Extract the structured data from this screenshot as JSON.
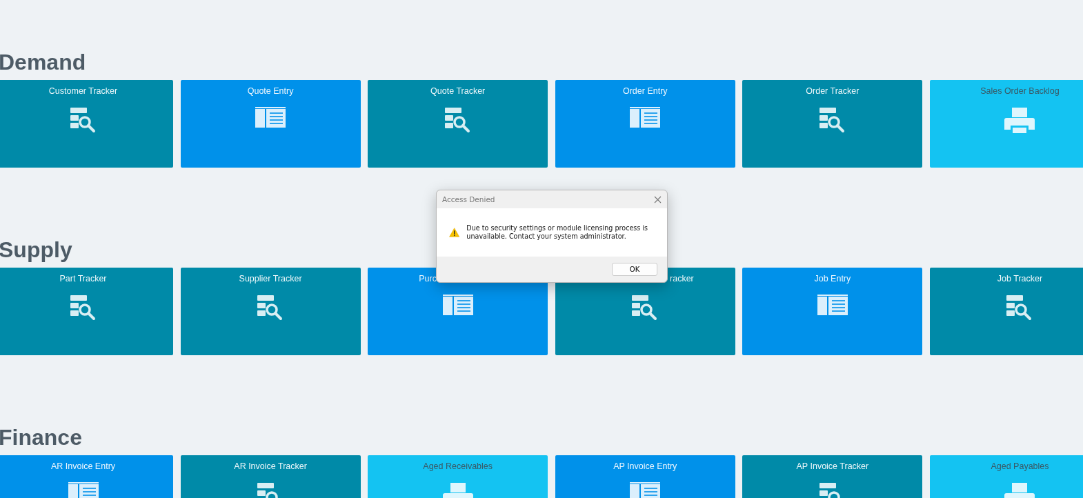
{
  "sections": [
    {
      "title": "Demand",
      "tiles": [
        {
          "label": "Customer Tracker",
          "kind": "tracker"
        },
        {
          "label": "Quote Entry",
          "kind": "entry"
        },
        {
          "label": "Quote Tracker",
          "kind": "tracker"
        },
        {
          "label": "Order Entry",
          "kind": "entry"
        },
        {
          "label": "Order Tracker",
          "kind": "tracker"
        },
        {
          "label": "Sales Order Backlog",
          "kind": "report"
        }
      ]
    },
    {
      "title": "Supply",
      "tiles": [
        {
          "label": "Part Tracker",
          "kind": "tracker"
        },
        {
          "label": "Supplier Tracker",
          "kind": "tracker"
        },
        {
          "label": "Purc",
          "kind": "entry",
          "clipped_right": true
        },
        {
          "label": "racker",
          "kind": "tracker",
          "clipped_left": true
        },
        {
          "label": "Job Entry",
          "kind": "entry"
        },
        {
          "label": "Job Tracker",
          "kind": "tracker"
        }
      ]
    },
    {
      "title": "Finance",
      "tiles": [
        {
          "label": "AR Invoice Entry",
          "kind": "entry"
        },
        {
          "label": "AR Invoice Tracker",
          "kind": "tracker"
        },
        {
          "label": "Aged Receivables",
          "kind": "report"
        },
        {
          "label": "AP Invoice Entry",
          "kind": "entry"
        },
        {
          "label": "AP Invoice Tracker",
          "kind": "tracker"
        },
        {
          "label": "Aged Payables",
          "kind": "report"
        }
      ]
    }
  ],
  "dialog": {
    "title": "Access Denied",
    "message": "Due to security settings or module licensing process is unavailable.  Contact your system administrator.",
    "button": "OK"
  }
}
